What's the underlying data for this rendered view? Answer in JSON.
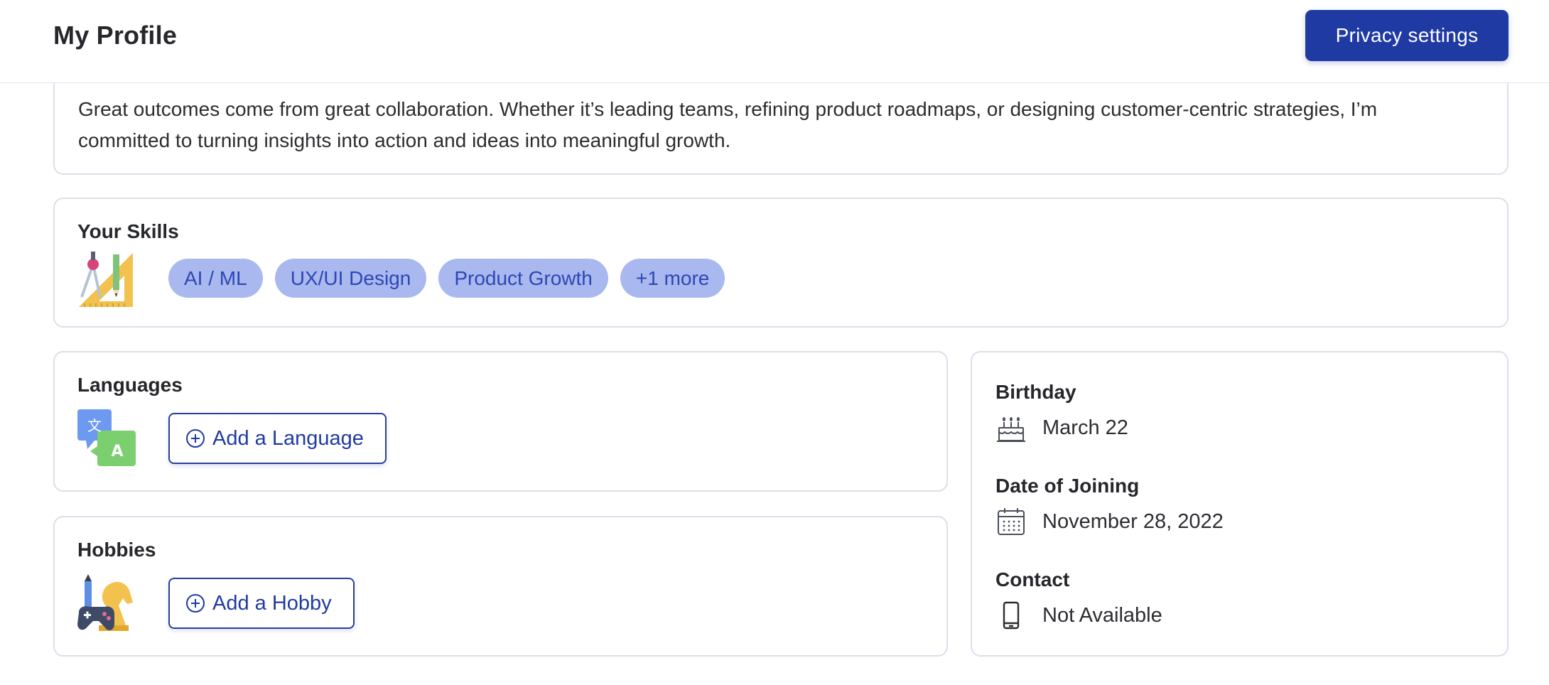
{
  "header": {
    "title": "My Profile",
    "privacy_button": "Privacy settings"
  },
  "about": {
    "text": "Great outcomes come from great collaboration. Whether it’s leading teams, refining product roadmaps, or designing customer-centric strategies, I’m committed to turning insights into action and ideas into meaningful growth."
  },
  "skills": {
    "title": "Your Skills",
    "icon": "design-tools-icon",
    "chips": [
      "AI / ML",
      "UX/UI Design",
      "Product Growth",
      "+1 more"
    ]
  },
  "languages": {
    "title": "Languages",
    "icon": "translate-icon",
    "add_label": "Add a Language"
  },
  "hobbies": {
    "title": "Hobbies",
    "icon": "hobbies-icon",
    "add_label": "Add a Hobby"
  },
  "details": {
    "birthday": {
      "label": "Birthday",
      "value": "March 22",
      "icon": "cake-icon"
    },
    "joining": {
      "label": "Date of Joining",
      "value": "November 28, 2022",
      "icon": "calendar-icon"
    },
    "contact": {
      "label": "Contact",
      "value": "Not Available",
      "icon": "phone-icon"
    }
  },
  "colors": {
    "primary": "#1f3aa3",
    "chip_bg": "#a9b8ef",
    "chip_text": "#2e47b4",
    "card_border": "#dcdfea"
  }
}
